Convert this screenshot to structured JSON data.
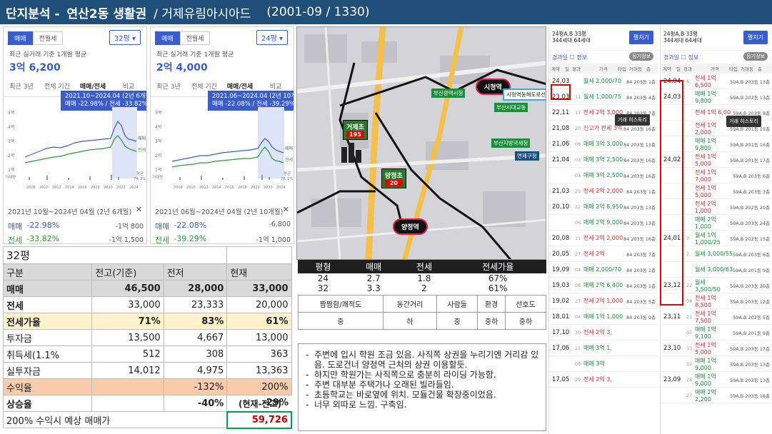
{
  "header": {
    "section": "단지분석 -",
    "area": "연산2동 생활권",
    "complex": "/ 거제유림아시아드",
    "meta": "(2001-09 / 1330)"
  },
  "left_panel_1": {
    "tabs": [
      "매매",
      "전월세"
    ],
    "size": "32평",
    "basis": "최근 실거래 기준 1개월 평균",
    "price": "3억 6,200",
    "periods": [
      "최근 3년",
      "전체 기간",
      "매매/전세",
      "비교"
    ],
    "tooltip_line1": "2021.10~2024.04 (2년 6개월)",
    "tooltip_line2": "매매 -22.98% / 전세 -33.82%",
    "yticks": [
      "5억",
      "4억",
      "3억",
      "2억",
      "1억"
    ],
    "xticks": [
      "2008",
      "2010",
      "2012",
      "2014",
      "2016",
      "2018",
      "2020",
      "2022",
      "2024"
    ],
    "legend_sale": "매매",
    "legend_jeon": "전세",
    "vol_label": "거래량",
    "avg_label": "평균",
    "avg_value": "74.3%",
    "footer_period": "2021년 10월~2024년 04월 (2년 6개월)",
    "sale_label": "매매",
    "sale_pct": "-22.98%",
    "sale_amt": "-1억 800",
    "jeon_label": "전세",
    "jeon_pct": "-33.82%",
    "jeon_amt": "-1억 1,500"
  },
  "left_panel_2": {
    "tabs": [
      "매매",
      "전월세"
    ],
    "size": "24평",
    "basis": "최근 실거래 기준 1개월 평균",
    "price": "2억 4,000",
    "periods": [
      "최근 3년",
      "전체 기간",
      "매매/전세",
      "비교"
    ],
    "tooltip_line1": "2021.06~2024.04 (2년 10개월)",
    "tooltip_line2": "매매 -22.08% / 전세 -39.29%",
    "yticks": [
      "5억",
      "4억",
      "3억",
      "2억",
      "1억"
    ],
    "xticks": [
      "2008",
      "2010",
      "2012",
      "2014",
      "2016",
      "2018",
      "2020",
      "2022",
      "2024"
    ],
    "legend_sale": "매매",
    "legend_jeon": "전세",
    "vol_label": "거래량",
    "avg_label": "평균",
    "avg_value": "76.1%",
    "footer_period": "2021년 06월~2024년 04월 (2년 10개월)",
    "sale_label": "매매",
    "sale_pct": "-22.08%",
    "sale_amt": "-6,800",
    "jeon_label": "전세",
    "jeon_pct": "-39.29%",
    "jeon_amt": "-1억 1,000"
  },
  "main_table": {
    "title": "32평",
    "header": [
      "구분",
      "전고(기준)",
      "전저",
      "현재"
    ],
    "rows": [
      [
        "매매",
        "46,500",
        "28,000",
        "33,000"
      ],
      [
        "전세",
        "33,000",
        "23,333",
        "20,000"
      ],
      [
        "전세가율",
        "71%",
        "83%",
        "61%"
      ],
      [
        "투자금",
        "13,500",
        "4,667",
        "13,000"
      ],
      [
        "취득세(1.1%",
        "512",
        "308",
        "363"
      ],
      [
        "실투자금",
        "14,012",
        "4,975",
        "13,363"
      ],
      [
        "수익율",
        "",
        "-132%",
        "200%"
      ],
      [
        "상승율",
        "",
        "-40%",
        "-29%"
      ]
    ],
    "note": "(현재-전고)",
    "forecast_label": "200% 수익시 예상 매매가",
    "forecast_value": "59,726"
  },
  "map": {
    "marker_geoje": "거제초",
    "marker_geoje_val": "195",
    "marker_yangjeong": "양정초",
    "marker_yangjeong_val": "20",
    "pill_city": "시청역",
    "pill_yangjeong": "양정역",
    "label_busan_station": "부산광역시청",
    "label_city_hall": "시청역동해도로선터",
    "label_busan_gov": "부산지방국세청",
    "label_yeonje": "연제구청",
    "label_busan_school": "부산시대교동"
  },
  "area_table": {
    "header": [
      "평형",
      "매매",
      "전세",
      "전세가율"
    ],
    "rows": [
      [
        "24",
        "2.7",
        "1.8",
        "67%"
      ],
      [
        "32",
        "3.3",
        "2",
        "61%"
      ]
    ]
  },
  "eval_table": {
    "header": [
      "짬짬함/쾌적도",
      "동간거리",
      "사람들",
      "환경",
      "선호도"
    ],
    "values": [
      "중",
      "하",
      "중",
      "중하",
      "중하"
    ]
  },
  "notes": [
    "주변에 입시 학원 조금 있음. 사직쪽 상권을 누리기엔 거리감 있음. 도로건너 양정역 근처의 상권 이용할듯.",
    "하지만 학원가는 사직쪽으로 충분히 라이딩 가능함.",
    "주변 대부분 주택가나 오래된 빌라들임.",
    "초등학교는 바로옆에 위치. 모듈건물 확장중이었음.",
    "너무 외따로 느낌. 구축임."
  ],
  "right_panel_1": {
    "name_line1": "24평A,B  33평",
    "name_line2": "344세대  64세대",
    "button": "펼치기",
    "sub": "경과일  ☐ 정보",
    "chip": "등기정보",
    "cols": [
      "계약",
      "일",
      "경과",
      "가격",
      "타입",
      "거래동",
      "층"
    ],
    "rows": [
      {
        "d": "24,03",
        "dd": "",
        "p": "월세 2,000/70",
        "t": "sale",
        "m": "84  203동  1층"
      },
      {
        "d": "23,03",
        "dd": "11",
        "p": "월세 1,000/75",
        "t": "sale",
        "m": "84  203동  4층"
      },
      {
        "d": "22,11",
        "dd": "17",
        "p": "전세 2억 3,000",
        "t": "jeon",
        "m": "84  203동  7층"
      },
      {
        "d": "21,08",
        "dd": "20",
        "p": "신고가 전세 3억",
        "t": "jeon",
        "m": "84  203동  16층"
      },
      {
        "d": "21,06",
        "dd": "06",
        "p": "매매 3억 3,000",
        "t": "sale",
        "m": "84  203동  13층"
      },
      {
        "d": "21,04",
        "dd": "03",
        "p": "매매 3억 2,500",
        "t": "sale",
        "m": "84  203동  16층"
      },
      {
        "d": "",
        "dd": "03",
        "p": "매매 3억 2,500",
        "t": "sale",
        "m": "84  203동  16층"
      },
      {
        "d": "21,03",
        "dd": "25",
        "p": "전세 2억 2,000",
        "t": "jeon",
        "m": "84  203동  1층"
      },
      {
        "d": "20,10",
        "dd": "22",
        "p": "매매 2억 8,950",
        "t": "sale",
        "m": "84  203동  13층"
      },
      {
        "d": "",
        "dd": "06",
        "p": "매매 2억 9,000",
        "t": "sale",
        "m": "84  203동  13층"
      },
      {
        "d": "20,08",
        "dd": "11",
        "p": "전세 2억 2,000",
        "t": "jeon",
        "m": "84  203동  16층"
      },
      {
        "d": "20,05",
        "dd": "27",
        "p": "전세 2억",
        "t": "jeon",
        "m": "84  203동  7층"
      },
      {
        "d": "19,09",
        "dd": "04",
        "p": "매매 2,000/70",
        "t": "sale",
        "m": "84  203동  1층"
      },
      {
        "d": "19,03",
        "dd": "08",
        "p": "매매 2억 6,400",
        "t": "sale",
        "m": "84  203동  1층"
      },
      {
        "d": "19,02",
        "dd": "27",
        "p": "전세 2억 1,000",
        "t": "jeon",
        "m": "84  203동  5층"
      },
      {
        "d": "18,01",
        "dd": "04",
        "p": "매매 1억 1,000",
        "t": "sale",
        "m": "84  203동  9층"
      },
      {
        "d": "17,10",
        "dd": "10",
        "p": "전세 2억 3,",
        "t": "jeon",
        "m": ""
      },
      {
        "d": "17,06",
        "dd": "22",
        "p": "매매 3억 1,",
        "t": "sale",
        "m": ""
      },
      {
        "d": "",
        "dd": "08",
        "p": "매매 3억",
        "t": "sale",
        "m": ""
      },
      {
        "d": "17,05",
        "dd": "29",
        "p": "전세 2억 3,",
        "t": "jeon",
        "m": ""
      }
    ],
    "history": "거래 히스토리"
  },
  "right_panel_2": {
    "name_line1": "24평A,B  33평",
    "name_line2": "344세대  64세대",
    "button": "펼치기",
    "sub": "경과일  ☐ 정보",
    "chip": "등기정보",
    "cols": [
      "계약",
      "일",
      "경과",
      "가격",
      "타입",
      "거래동",
      "층"
    ],
    "rows": [
      {
        "d": "24,04",
        "dd": "6",
        "p": "전세 1억 6,500",
        "t": "jeon",
        "m": "59A,B  203동  13층"
      },
      {
        "d": "24,03",
        "dd": "",
        "p": "매매 1억 9,800",
        "t": "sale",
        "m": "59A,B  202동  13층"
      },
      {
        "d": "",
        "dd": "",
        "p": "전세 1억 6,00",
        "t": "jeon",
        "m": "59A,B  203동  8층"
      },
      {
        "d": "",
        "dd": "",
        "p": "전세 1억 2,000",
        "t": "jeon",
        "m": "59A,B  201동  15층"
      },
      {
        "d": "",
        "dd": "",
        "p": "매매 1억 9,800",
        "t": "sale",
        "m": "59A,B  201동  16층"
      },
      {
        "d": "24,02",
        "dd": "",
        "p": "전세 1억 5,000",
        "t": "jeon",
        "m": "59A,B  201동  17층"
      },
      {
        "d": "",
        "dd": "",
        "p": "전세 1억 7,000",
        "t": "jeon",
        "m": "59A,B  203동  6층"
      },
      {
        "d": "",
        "dd": "",
        "p": "전세 1억 5,000",
        "t": "jeon",
        "m": "59A,B  203동  3층"
      },
      {
        "d": "",
        "dd": "",
        "p": "전세 2억 1,000",
        "t": "jeon",
        "m": "59A,B  202동  20층"
      },
      {
        "d": "",
        "dd": "",
        "p": "매매 2억 1,000",
        "t": "sale",
        "m": "59A,B  203동  24층"
      },
      {
        "d": "24,01",
        "dd": "3",
        "p": "월세 1억 1,000/25",
        "t": "sale",
        "m": "59A,B  202동  15층"
      },
      {
        "d": "",
        "dd": "2",
        "p": "월세 3,000/55",
        "t": "sale",
        "m": "59A,B  203동  6층"
      },
      {
        "d": "",
        "dd": "",
        "p": "월세 3,000/63",
        "t": "sale",
        "m": "59A,B  201동  9층"
      },
      {
        "d": "23,12",
        "dd": "22",
        "p": "월세 3,500/50",
        "t": "sale",
        "m": "59A,B  203동  20층"
      },
      {
        "d": "",
        "dd": "08",
        "p": "전세 1억 8,500",
        "t": "jeon",
        "m": "59A,B  203동  12층"
      },
      {
        "d": "23,11",
        "dd": "21",
        "p": "전세 1억 7,500",
        "t": "jeon",
        "m": "59A,B  202동  5층"
      },
      {
        "d": "",
        "dd": "07",
        "p": "매매 1억 9,100",
        "t": "sale",
        "m": "59A,B  201동  9층"
      },
      {
        "d": "23,10",
        "dd": "13",
        "p": "전세 1억 5,000",
        "t": "jeon",
        "m": "59A,B  203동  17층"
      },
      {
        "d": "",
        "dd": "12",
        "p": "매매 1억 9,000",
        "t": "sale",
        "m": "59A,B  203동  13층"
      },
      {
        "d": "23,09",
        "dd": "28",
        "p": "매매 1억 9,000",
        "t": "sale",
        "m": "59A,B  203동  13층"
      },
      {
        "d": "",
        "dd": "27",
        "p": "매매 2억 2,200",
        "t": "sale",
        "m": "59A,B  203동  18층"
      }
    ],
    "history": "거래 히스토리"
  }
}
